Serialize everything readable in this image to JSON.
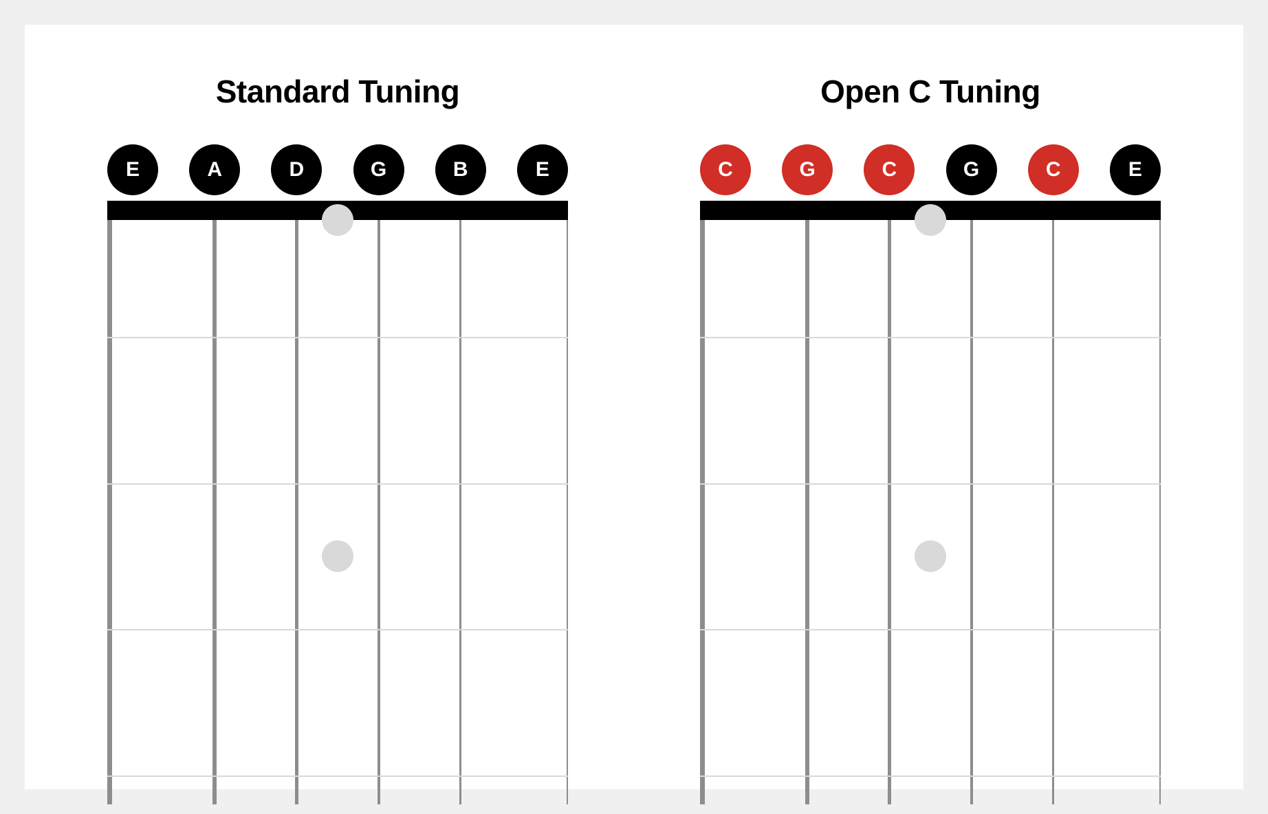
{
  "tunings": [
    {
      "title": "Standard Tuning",
      "strings": [
        {
          "note": "E",
          "color": "black"
        },
        {
          "note": "A",
          "color": "black"
        },
        {
          "note": "D",
          "color": "black"
        },
        {
          "note": "G",
          "color": "black"
        },
        {
          "note": "B",
          "color": "black"
        },
        {
          "note": "E",
          "color": "black"
        }
      ]
    },
    {
      "title": "Open C Tuning",
      "strings": [
        {
          "note": "C",
          "color": "red"
        },
        {
          "note": "G",
          "color": "red"
        },
        {
          "note": "C",
          "color": "red"
        },
        {
          "note": "G",
          "color": "black"
        },
        {
          "note": "C",
          "color": "red"
        },
        {
          "note": "E",
          "color": "black"
        }
      ]
    }
  ],
  "fretboard": {
    "string_thickness_px": [
      7,
      6,
      5,
      4,
      3,
      2
    ],
    "fret_positions_pct": [
      20,
      45,
      70,
      95
    ],
    "marker_frets": [
      3,
      5
    ]
  }
}
